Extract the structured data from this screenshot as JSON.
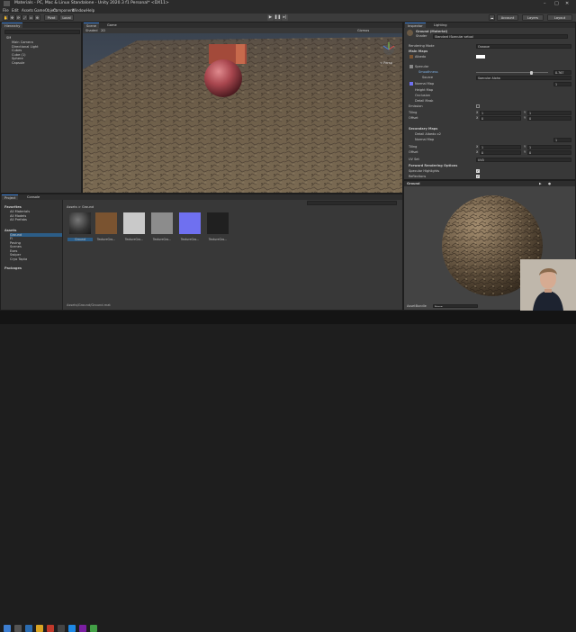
{
  "title": {
    "text": "Materials - PC, Mac & Linux Standalone - Unity 2020.3 f1 Personal* <DX11>"
  },
  "menu": [
    "File",
    "Edit",
    "Assets",
    "GameObject",
    "Component",
    "Window",
    "Help"
  ],
  "toolbar": {
    "account": "Account",
    "layers": "Layers",
    "layout": "Layout",
    "pivot": "Pivot",
    "local": "Local"
  },
  "hierarchy": {
    "tab": "Hierarchy",
    "scene": "SM",
    "items": [
      "Main Camera",
      "Directional Light",
      "Cubes",
      "Cube (1)",
      "Sphere",
      "Capsule"
    ]
  },
  "scene": {
    "tab_scene": "Scene",
    "tab_game": "Game",
    "shading": "Shaded",
    "gizmos": "Gizmos",
    "persp": "< Persp"
  },
  "project": {
    "tab_project": "Project",
    "tab_console": "Console",
    "favorites": "Favorites",
    "fav_items": [
      "All Materials",
      "All Models",
      "All Prefabs"
    ],
    "assets": "Assets",
    "asset_items": [
      "Ground",
      "Fi",
      "Paving",
      "Scenes",
      "Exes",
      "Swiper",
      "Cryo Tapta"
    ],
    "packages": "Packages",
    "breadcrumb": "Assets > Ground",
    "path": "Assets/Ground/Ground.mat",
    "thumbs": [
      {
        "label": "Ground",
        "color": "#3a3a3a"
      },
      {
        "label": "TextureGro...",
        "color": "#7a5330"
      },
      {
        "label": "TextureGro...",
        "color": "#c9c9c9"
      },
      {
        "label": "TextureGro...",
        "color": "#8c8c8c"
      },
      {
        "label": "TextureGro...",
        "color": "#6f70f0"
      },
      {
        "label": "TextureGro...",
        "color": "#202020"
      }
    ]
  },
  "inspector": {
    "tab_inspector": "Inspector",
    "tab_lighting": "Lighting",
    "material_name": "Ground (Material)",
    "shader_label": "Shader",
    "shader_value": "Standard (Specular setup)",
    "rendering_mode_label": "Rendering Mode",
    "rendering_mode_value": "Opaque",
    "main_maps": "Main Maps",
    "albedo": "Albedo",
    "specular": "Specular",
    "smoothness": "Smoothness",
    "smoothness_value": "0.767",
    "smoothness_fraction": 0.77,
    "source": "Source",
    "source_value": "Specular Alpha",
    "normal_map": "Normal Map",
    "normal_value": "1",
    "height_map": "Height Map",
    "occlusion": "Occlusion",
    "detail_mask": "Detail Mask",
    "emission": "Emission",
    "tiling": "Tiling",
    "offset": "Offset",
    "x": "X",
    "y": "Y",
    "tiling_x": "1",
    "tiling_y": "1",
    "offset_x": "0",
    "offset_y": "0",
    "secondary_maps": "Secondary Maps",
    "detail_albedo": "Detail Albedo x2",
    "normal_map2": "Normal Map",
    "normal2_value": "1",
    "tiling2": "Tiling",
    "offset2": "Offset",
    "tiling2_x": "1",
    "tiling2_y": "1",
    "offset2_x": "0",
    "offset2_y": "0",
    "uv_set": "UV Set",
    "uv_set_value": "UV0",
    "forward_options": "Forward Rendering Options",
    "specular_highlights": "Specular Highlights",
    "reflections": "Reflections"
  },
  "preview": {
    "title": "Ground",
    "asset_bundle": "AssetBundle",
    "asset_bundle_value": "None"
  },
  "colors": {
    "accent": "#3d7ed0",
    "sphere": "#a8464e",
    "ground": "#6b5a45",
    "normal_map": "#6f70f0"
  }
}
